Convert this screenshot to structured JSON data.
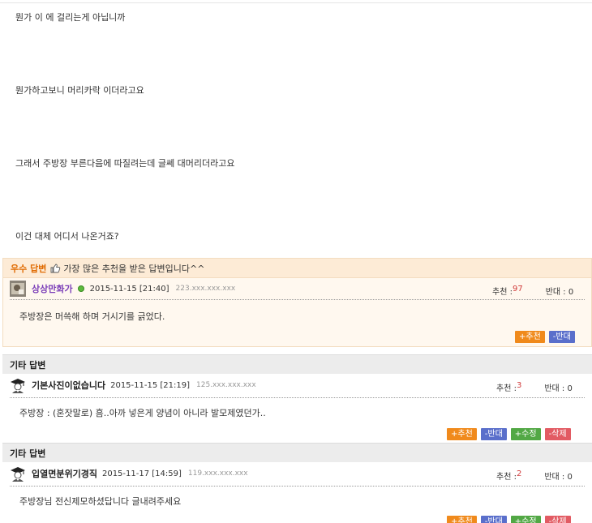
{
  "question": {
    "lines": [
      "뭔가 이 에 걸리는게 아닙니까",
      "뭔가하고보니 머리카락 이더라고요",
      "그래서 주방장 부른다음에 따질려는데 글쎄 대머리더라고요",
      "이건 대체 어디서 나온거죠?"
    ]
  },
  "best_answer": {
    "title": "우수 답변",
    "description": "가장 많은 추천을 받은 답변입니다^^",
    "nickname": "상상만화가",
    "date": "2015-11-15 [21:40]",
    "ip": "223.xxx.xxx.xxx",
    "recommend_label": "추천 : ",
    "recommend_count": "97",
    "oppose_label": "반대 : 0",
    "body": "주방장은 머쓱해 하며 거시기를 긁었다.",
    "buttons": {
      "recommend": "+추천",
      "oppose": "-반대"
    }
  },
  "other_answers": [
    {
      "section_title": "기타 답변",
      "nickname": "기본사진이없습니다",
      "date": "2015-11-15 [21:19]",
      "ip": "125.xxx.xxx.xxx",
      "recommend_label": "추천 : ",
      "recommend_count": "3",
      "oppose_label": "반대 : 0",
      "body": "주방장 : (혼잣말로) 흠..아까 넣은게 양념이 아니라 발모제였던가..",
      "buttons": {
        "recommend": "+추천",
        "oppose": "-반대",
        "edit": "+수정",
        "delete": "-삭제"
      }
    },
    {
      "section_title": "기타 답변",
      "nickname": "입열면분위기경직",
      "date": "2015-11-17 [14:59]",
      "ip": "119.xxx.xxx.xxx",
      "recommend_label": "추천 : ",
      "recommend_count": "2",
      "oppose_label": "반대 : 0",
      "body": "주방장님 전신제모하셨답니다 글내려주세요",
      "buttons": {
        "recommend": "+추천",
        "oppose": "-반대",
        "edit": "+수정",
        "delete": "-삭제"
      }
    }
  ]
}
